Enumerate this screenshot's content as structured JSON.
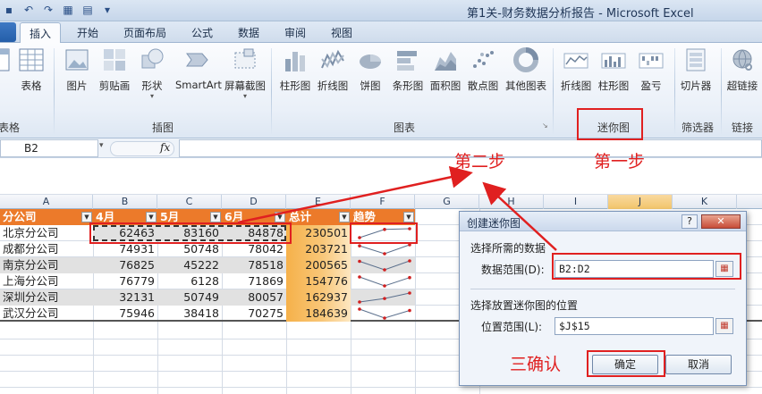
{
  "window": {
    "title": "第1关-财务数据分析报告 - Microsoft Excel"
  },
  "tabs": [
    "插入",
    "开始",
    "页面布局",
    "公式",
    "数据",
    "审阅",
    "视图"
  ],
  "active_tab": "插入",
  "ribbon": {
    "buttons": {
      "table": "表格",
      "picture": "图片",
      "clipart": "剪贴画",
      "shapes": "形状",
      "smartart": "SmartArt",
      "screenshot": "屏幕截图",
      "col_chart": "柱形图",
      "line_chart": "折线图",
      "pie_chart": "饼图",
      "bar_chart": "条形图",
      "area_chart": "面积图",
      "scatter_chart": "散点图",
      "other_chart": "其他图表",
      "spark_line": "折线图",
      "spark_col": "柱形图",
      "spark_winloss": "盈亏",
      "slicer": "切片器",
      "hyperlink": "超链接"
    },
    "groups": {
      "tables": "表格",
      "illustrations": "插图",
      "charts": "图表",
      "sparklines": "迷你图",
      "filter": "筛选器",
      "links": "链接"
    }
  },
  "formula_bar": {
    "name_box": "B2",
    "fx": "fx",
    "formula": ""
  },
  "columns": [
    "A",
    "B",
    "C",
    "D",
    "E",
    "F",
    "G",
    "H",
    "I",
    "J",
    "K"
  ],
  "table": {
    "headers": [
      "分公司",
      "4月",
      "5月",
      "6月",
      "总计",
      "趋势"
    ],
    "rows": [
      {
        "name": "北京分公司",
        "apr": "62463",
        "may": "83160",
        "jun": "84878",
        "total": "230501"
      },
      {
        "name": "成都分公司",
        "apr": "74931",
        "may": "50748",
        "jun": "78042",
        "total": "203721"
      },
      {
        "name": "南京分公司",
        "apr": "76825",
        "may": "45222",
        "jun": "78518",
        "total": "200565"
      },
      {
        "name": "上海分公司",
        "apr": "76779",
        "may": "6128",
        "jun": "71869",
        "total": "154776"
      },
      {
        "name": "深圳分公司",
        "apr": "32131",
        "may": "50749",
        "jun": "80057",
        "total": "162937"
      },
      {
        "name": "武汉分公司",
        "apr": "75946",
        "may": "38418",
        "jun": "70275",
        "total": "184639"
      }
    ]
  },
  "dialog": {
    "title": "创建迷你图",
    "help": "?",
    "close": "✕",
    "section1": "选择所需的数据",
    "data_range_label": "数据范围(D):",
    "data_range_value": "B2:D2",
    "section2": "选择放置迷你图的位置",
    "location_label": "位置范围(L):",
    "location_value": "$J$15",
    "ok": "确定",
    "cancel": "取消"
  },
  "annotations": {
    "step1": "第一步",
    "step2": "第二步",
    "step3": "三确认"
  },
  "colors": {
    "header_orange": "#ec7a2a",
    "total_gold": "#f6b14a",
    "annotation_red": "#e02020",
    "band_gray": "#e1e1e1"
  }
}
